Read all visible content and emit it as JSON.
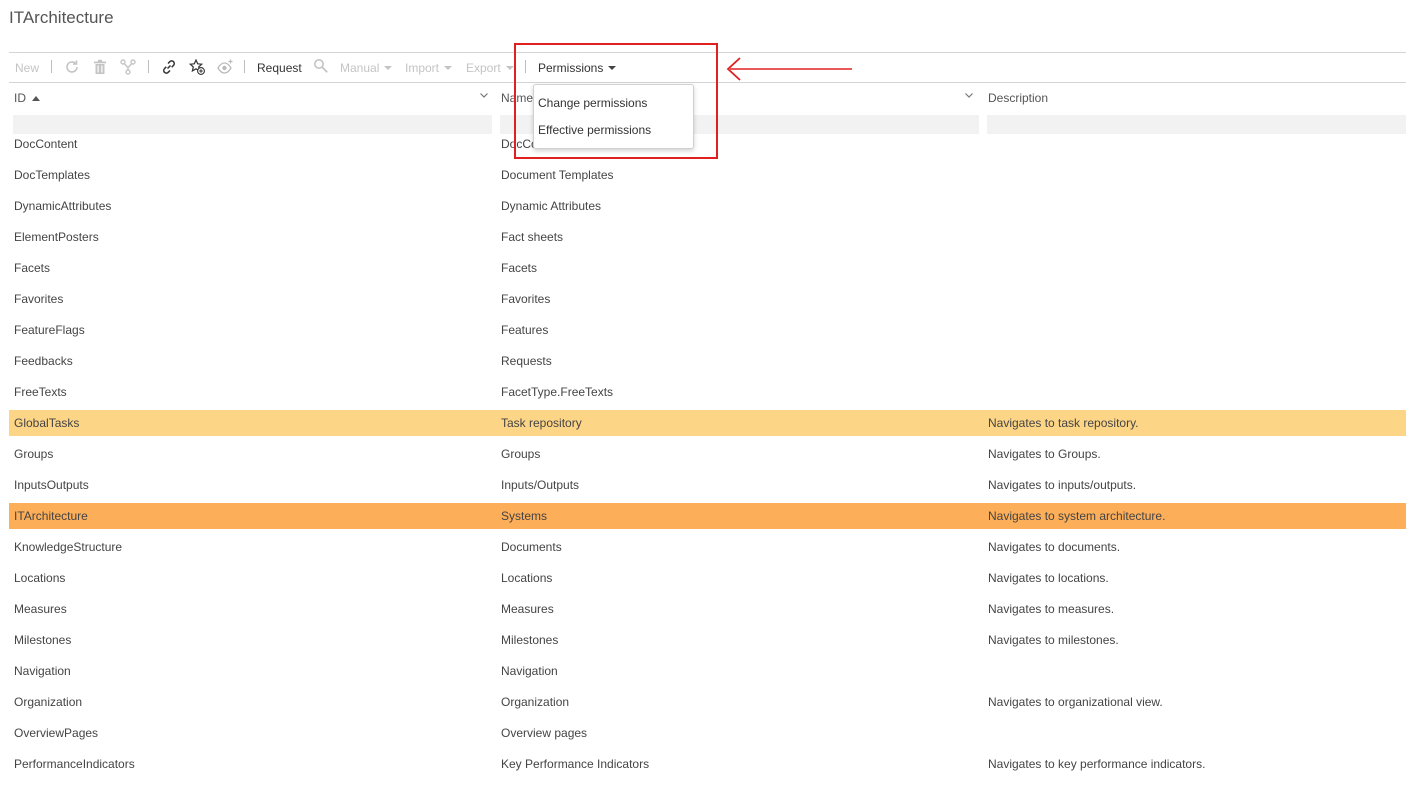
{
  "page": {
    "title": "ITArchitecture"
  },
  "toolbar": {
    "new_label": "New",
    "request_label": "Request",
    "manual_label": "Manual",
    "import_label": "Import",
    "export_label": "Export",
    "permissions_label": "Permissions",
    "icons": [
      "refresh-icon",
      "trash-icon",
      "branch-icon",
      "link-icon",
      "star-add-icon",
      "eye-add-icon",
      "search-icon"
    ]
  },
  "permissions_menu": {
    "items": [
      "Change permissions",
      "Effective permissions"
    ]
  },
  "table": {
    "columns": {
      "id": "ID",
      "name": "Name",
      "description": "Description"
    },
    "partial_row": {
      "id": "DocContent",
      "name": "DocCo"
    },
    "rows": [
      {
        "id": "DocTemplates",
        "name": "Document Templates",
        "description": ""
      },
      {
        "id": "DynamicAttributes",
        "name": "Dynamic Attributes",
        "description": ""
      },
      {
        "id": "ElementPosters",
        "name": "Fact sheets",
        "description": ""
      },
      {
        "id": "Facets",
        "name": "Facets",
        "description": ""
      },
      {
        "id": "Favorites",
        "name": "Favorites",
        "description": ""
      },
      {
        "id": "FeatureFlags",
        "name": "Features",
        "description": ""
      },
      {
        "id": "Feedbacks",
        "name": "Requests",
        "description": ""
      },
      {
        "id": "FreeTexts",
        "name": "FacetType.FreeTexts",
        "description": ""
      },
      {
        "id": "GlobalTasks",
        "name": "Task repository",
        "description": "Navigates to task repository."
      },
      {
        "id": "Groups",
        "name": "Groups",
        "description": "Navigates to Groups."
      },
      {
        "id": "InputsOutputs",
        "name": "Inputs/Outputs",
        "description": "Navigates to inputs/outputs."
      },
      {
        "id": "ITArchitecture",
        "name": "Systems",
        "description": "Navigates to system architecture."
      },
      {
        "id": "KnowledgeStructure",
        "name": "Documents",
        "description": "Navigates to documents."
      },
      {
        "id": "Locations",
        "name": "Locations",
        "description": "Navigates to locations."
      },
      {
        "id": "Measures",
        "name": "Measures",
        "description": "Navigates to measures."
      },
      {
        "id": "Milestones",
        "name": "Milestones",
        "description": "Navigates to milestones."
      },
      {
        "id": "Navigation",
        "name": "Navigation",
        "description": ""
      },
      {
        "id": "Organization",
        "name": "Organization",
        "description": "Navigates to organizational view."
      },
      {
        "id": "OverviewPages",
        "name": "Overview pages",
        "description": ""
      },
      {
        "id": "PerformanceIndicators",
        "name": "Key Performance Indicators",
        "description": "Navigates to key performance indicators."
      }
    ],
    "hover_row_id": "GlobalTasks",
    "selected_row_id": "ITArchitecture"
  },
  "colors": {
    "hover_row": "#fdd586",
    "selected_row": "#fdae59",
    "annotation": "#e02020"
  }
}
